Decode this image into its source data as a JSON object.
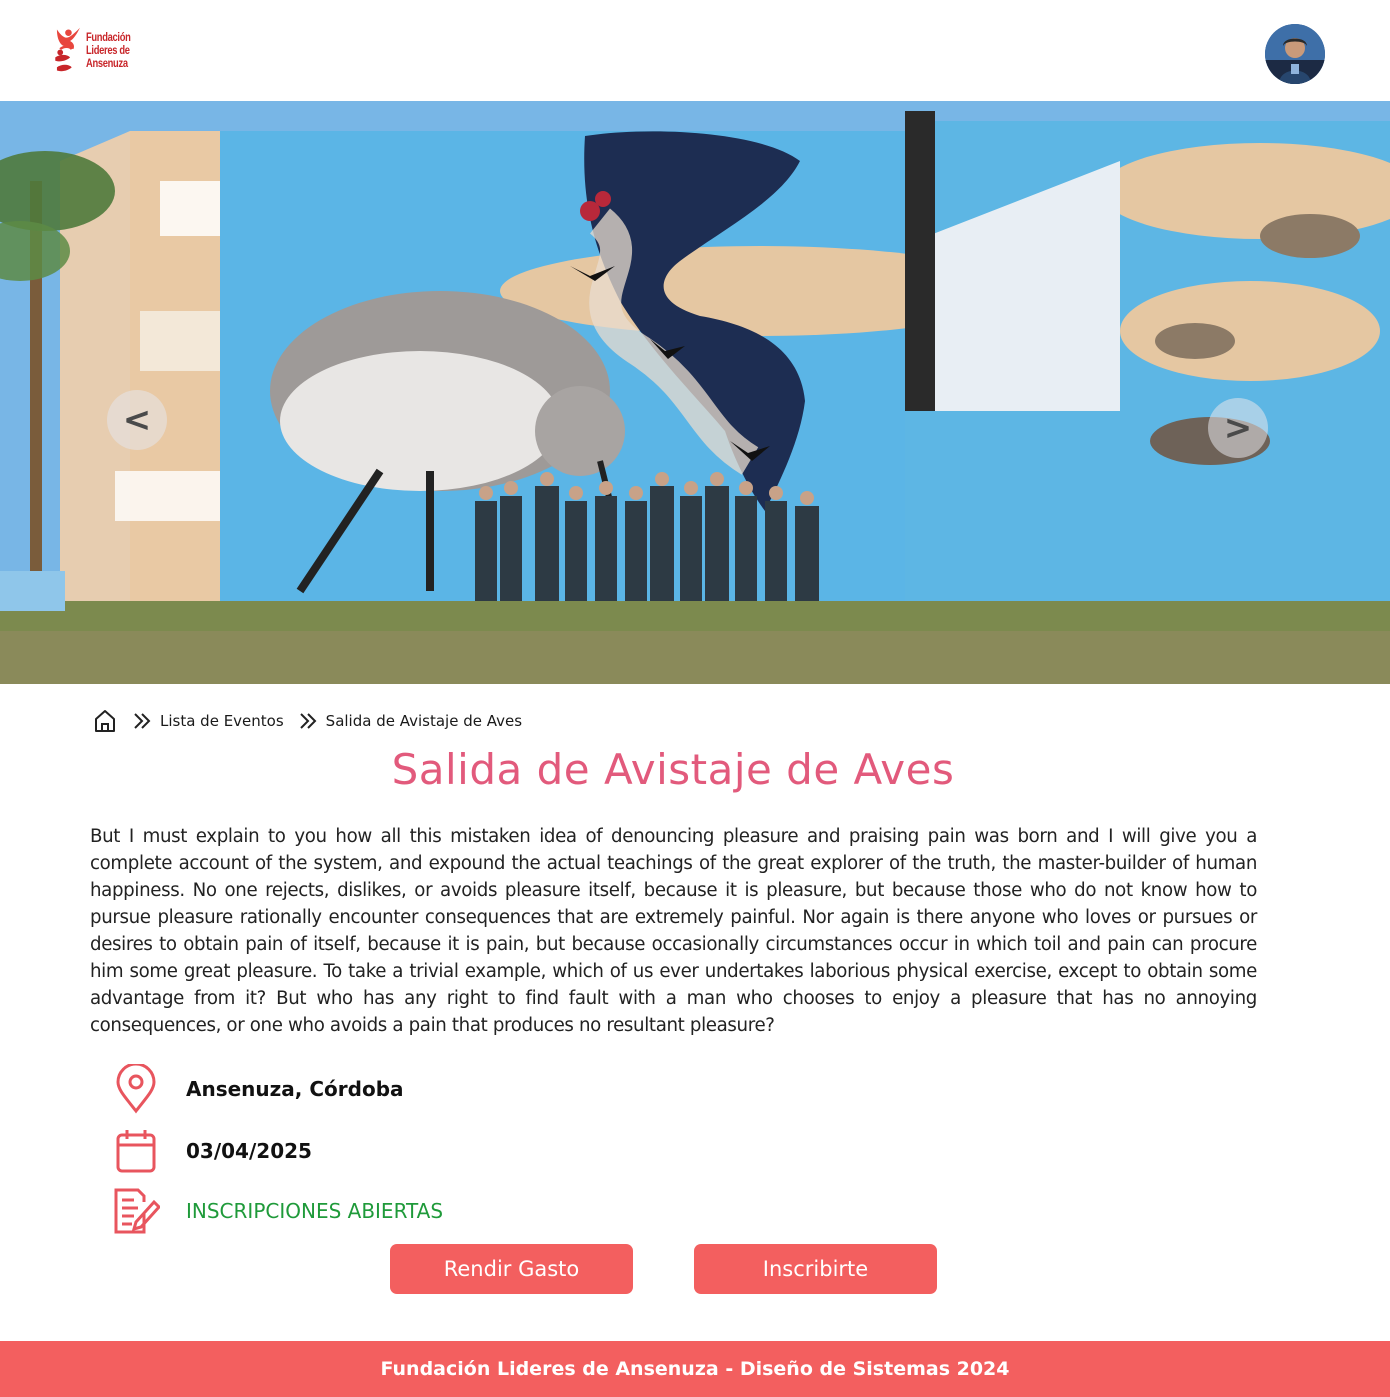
{
  "header": {
    "logo_lines": [
      "Fundación",
      "Lideres de",
      "Ansenuza"
    ],
    "avatar_alt": "avatar"
  },
  "hero": {
    "prev_label": "<",
    "next_label": ">"
  },
  "breadcrumb": {
    "home_icon": "home-icon",
    "items": [
      "Lista de Eventos",
      "Salida de Avistaje de Aves"
    ]
  },
  "event": {
    "title": "Salida de Avistaje de Aves",
    "description": "But I must explain to you how all this mistaken idea of denouncing pleasure and praising pain was born and I will give you a complete account of the system, and expound the actual teachings of the great explorer of the truth, the master-builder of human happiness. No one rejects, dislikes, or avoids pleasure itself, because it is pleasure, but because those who do not know how to pursue pleasure rationally encounter consequences that are extremely painful. Nor again is there anyone who loves or pursues or desires to obtain pain of itself, because it is pain, but because occasionally circumstances occur in which toil and pain can procure him some great pleasure. To take a trivial example, which of us ever undertakes laborious physical exercise, except to obtain some advantage from it? But who has any right to find fault with a man who chooses to enjoy a pleasure that has no annoying consequences, or one who avoids a pain that produces no resultant pleasure?",
    "location": "Ansenuza, Córdoba",
    "date": "03/04/2025",
    "status": "INSCRIPCIONES ABIERTAS"
  },
  "actions": {
    "expense_label": "Rendir Gasto",
    "register_label": "Inscribirte"
  },
  "footer": {
    "text": "Fundación Lideres de Ansenuza - Diseño de Sistemas 2024"
  },
  "colors": {
    "accent": "#f35f5f",
    "title": "#e25a7c",
    "status_open": "#1f9a3a",
    "icon": "#e8555e"
  }
}
